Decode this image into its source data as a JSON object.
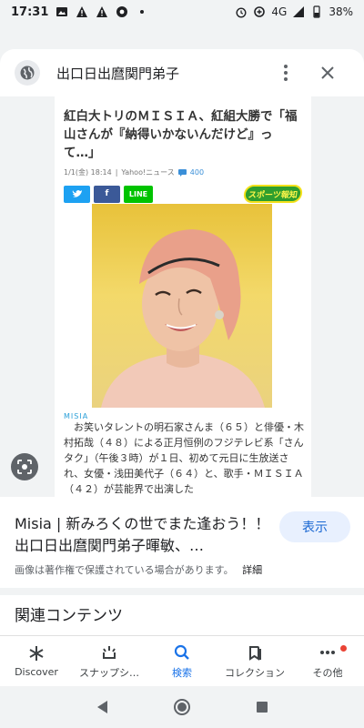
{
  "status_bar": {
    "time": "17:31",
    "network": "4G",
    "battery": "38%"
  },
  "header": {
    "page_title": "出口日出麿関門弟子"
  },
  "article": {
    "title": "紅白大トリのＭＩＳＩＡ、紅組大勝で「福山さんが『納得いかないんだけど』って…」",
    "date": "1/1(金) 18:14",
    "source": "Yahoo!ニュース",
    "comments": "400",
    "share_twitter": "Twitter",
    "share_facebook": "f",
    "share_line": "LINE",
    "sports_logo": "スポーツ報知",
    "caption": "MISIA",
    "body": "　お笑いタレントの明石家さんま（６５）と俳優・木村拓哉（４８）による正月恒例のフジテレビ系「さんタク」（午後３時）が１日、初めて元日に生放送され、女優・浅田美代子（６４）と、歌手・ＭＩＳＩＡ（４２）が芸能界で出演した"
  },
  "result": {
    "title": "Misia | 新みろくの世でまた逢おう！！出口日出麿関門弟子暉敏、…",
    "visit_label": "表示",
    "copyright": "画像は著作権で保護されている場合があります。",
    "detail_label": "詳細",
    "related_label": "関連コンテンツ"
  },
  "bottom_nav": [
    {
      "label": "Discover",
      "icon": "asterisk-icon"
    },
    {
      "label": "スナップシ…",
      "icon": "snapshot-icon"
    },
    {
      "label": "検索",
      "icon": "search-icon"
    },
    {
      "label": "コレクション",
      "icon": "collections-icon"
    },
    {
      "label": "その他",
      "icon": "more-icon"
    }
  ],
  "colors": {
    "accent": "#1a73e8",
    "chip_bg": "#e8f0fe",
    "badge": "#ea4335"
  }
}
